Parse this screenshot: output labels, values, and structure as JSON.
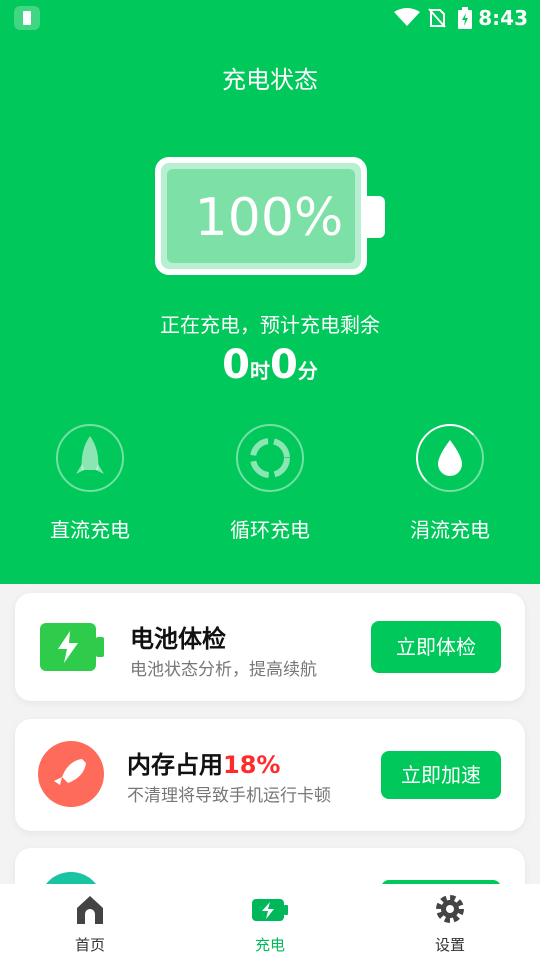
{
  "status_bar": {
    "time": "8:43"
  },
  "header": {
    "title": "充电状态"
  },
  "battery": {
    "percent_text": "100%",
    "level": 1.0
  },
  "charging": {
    "status_text": "正在充电，预计充电剩余",
    "hours": "0",
    "hours_unit": "时",
    "minutes": "0",
    "minutes_unit": "分"
  },
  "modes": [
    {
      "label": "直流充电",
      "icon": "rocket-icon"
    },
    {
      "label": "循环充电",
      "icon": "recycle-icon"
    },
    {
      "label": "涓流充电",
      "icon": "drop-icon"
    }
  ],
  "cards": {
    "battery_check": {
      "title": "电池体检",
      "subtitle": "电池状态分析，提高续航",
      "button": "立即体检",
      "icon": "battery-icon"
    },
    "memory": {
      "title": "内存占用",
      "percent": "18%",
      "subtitle": "不清理将导致手机运行卡顿",
      "button": "立即加速",
      "icon": "rocket-icon"
    }
  },
  "bottom_nav": [
    {
      "label": "首页",
      "icon": "home-icon"
    },
    {
      "label": "充电",
      "icon": "battery-charge-icon",
      "active": true
    },
    {
      "label": "设置",
      "icon": "gear-icon"
    }
  ],
  "colors": {
    "primary": "#00c85a",
    "accent_red": "#ff2a2a",
    "memory_icon": "#ff6b5a",
    "third_icon": "#18c4a1"
  }
}
